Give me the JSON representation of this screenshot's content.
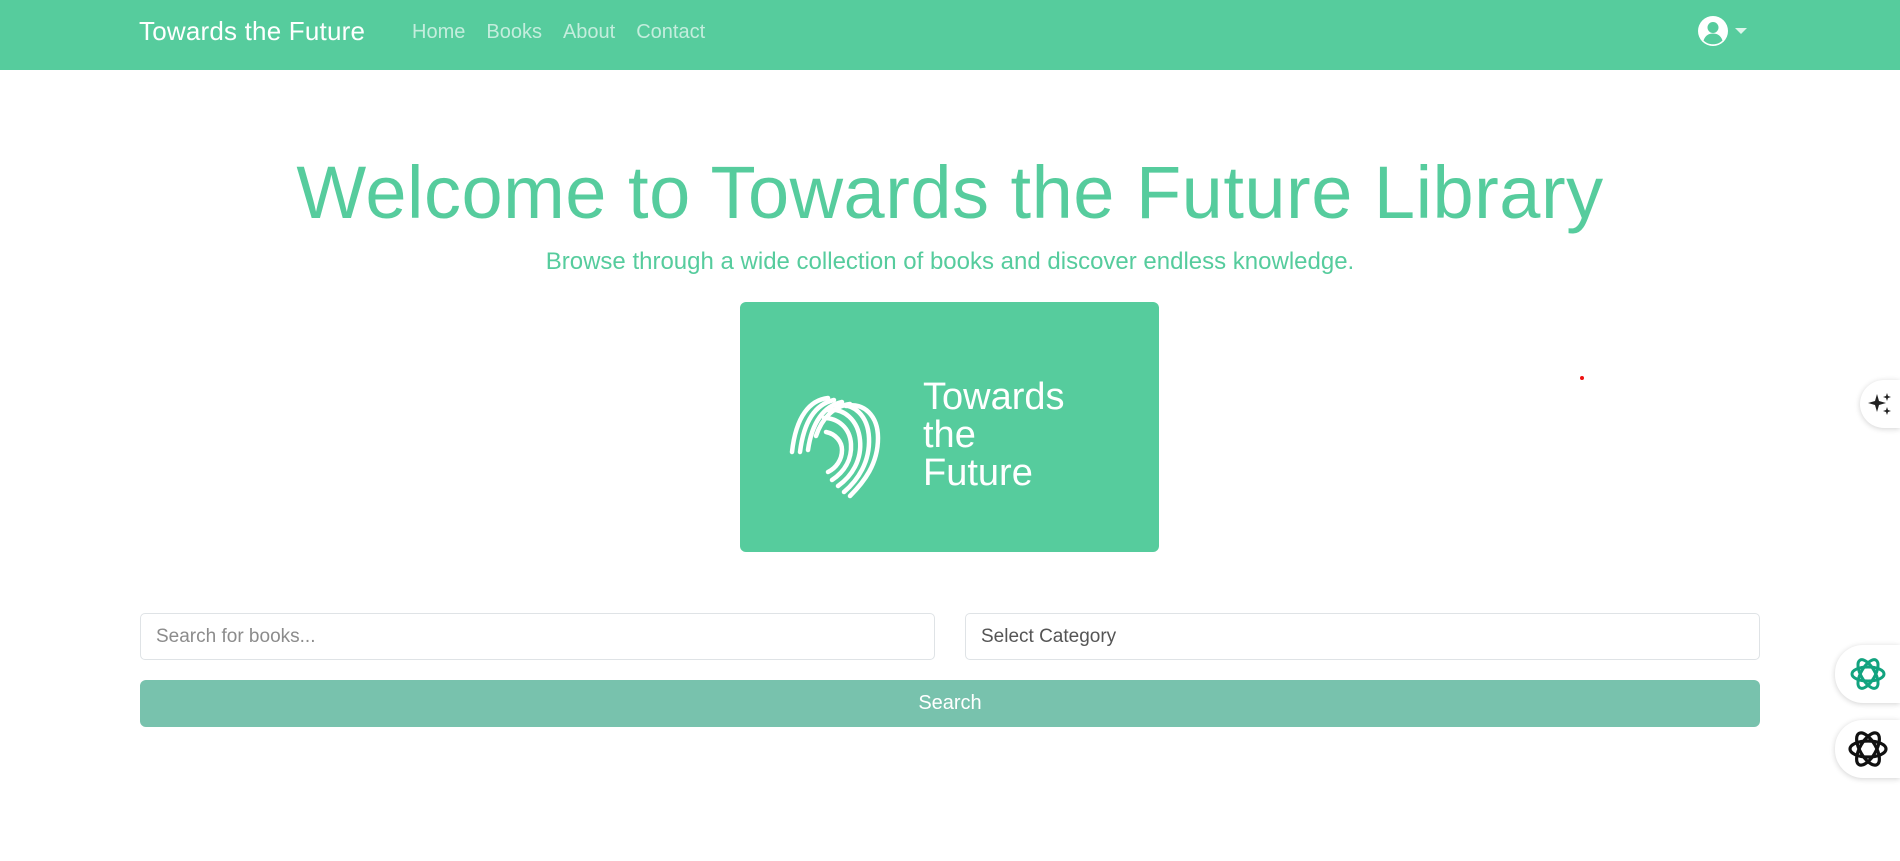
{
  "navbar": {
    "brand": "Towards the Future",
    "links": [
      "Home",
      "Books",
      "About",
      "Contact"
    ],
    "user_icon": "user-circle-icon"
  },
  "hero": {
    "title": "Welcome to Towards the Future Library",
    "subtitle": "Browse through a wide collection of books and discover endless knowledge.",
    "logo_lines": [
      "Towards",
      "the",
      "Future"
    ]
  },
  "search": {
    "input_placeholder": "Search for books...",
    "category_selected": "Select Category",
    "button_label": "Search"
  },
  "colors": {
    "primary": "#56cc9d",
    "button": "#78c2ad"
  },
  "floating": {
    "icons": [
      "sparkle-icon",
      "chatgpt-green-icon",
      "chatgpt-black-icon"
    ]
  }
}
